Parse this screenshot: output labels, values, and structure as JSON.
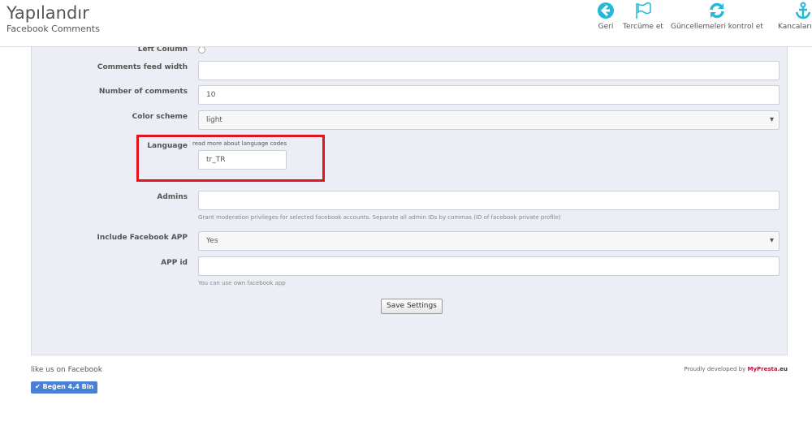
{
  "header": {
    "title": "Yapılandır",
    "subtitle": "Facebook Comments",
    "toolbar": [
      {
        "label": "Geri",
        "icon": "back-arrow-icon"
      },
      {
        "label": "Tercüme et",
        "icon": "flag-icon"
      },
      {
        "label": "Güncellemeleri kontrol et",
        "icon": "refresh-icon"
      },
      {
        "label": "Kancaları yön",
        "icon": "anchor-icon"
      }
    ]
  },
  "form": {
    "left_column": {
      "label": "Left Column"
    },
    "feed_width": {
      "label": "Comments feed width",
      "value": ""
    },
    "num_comments": {
      "label": "Number of comments",
      "value": "10"
    },
    "color_scheme": {
      "label": "Color scheme",
      "value": "light"
    },
    "language": {
      "label": "Language",
      "link": "read more about language codes",
      "value": "tr_TR"
    },
    "admins": {
      "label": "Admins",
      "value": "",
      "help": "Grant moderation privileges for selected facebook accounts. Separate all admin IDs by commas (ID of facebook private profile)"
    },
    "include_app": {
      "label": "Include Facebook APP",
      "value": "Yes"
    },
    "app_id": {
      "label": "APP id",
      "value": "",
      "help": "You can use own facebook app"
    },
    "save": "Save Settings"
  },
  "footer": {
    "like_text": "like us on Facebook",
    "like_button": "Beğen 4,4 Bin",
    "dev_text": "Proudly developed by",
    "brand": "MyPresta",
    "brand_suffix": ".eu"
  },
  "colors": {
    "accent": "#25b9d7",
    "highlight": "#e0131f",
    "brand": "#c4173d"
  }
}
